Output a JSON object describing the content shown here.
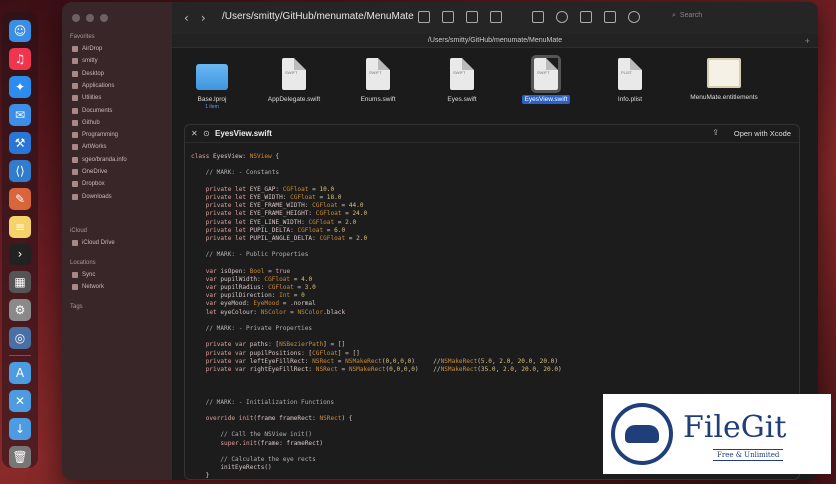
{
  "dock": {
    "apps": [
      {
        "name": "finder-icon",
        "color": "#3a8ee6",
        "glyph": "☺"
      },
      {
        "name": "music-icon",
        "color": "#f0364f",
        "glyph": "♫"
      },
      {
        "name": "safari-icon",
        "color": "#2d8cf0",
        "glyph": "✦"
      },
      {
        "name": "mail-icon",
        "color": "#3b8fe8",
        "glyph": "✉"
      },
      {
        "name": "xcode-icon",
        "color": "#2a76d6",
        "glyph": "⚒"
      },
      {
        "name": "vscode-icon",
        "color": "#2f7dcc",
        "glyph": "⟨⟩"
      },
      {
        "name": "ruler-icon",
        "color": "#d8663a",
        "glyph": "✎"
      },
      {
        "name": "notes-icon",
        "color": "#f5d36a",
        "glyph": "≡"
      },
      {
        "name": "terminal-icon",
        "color": "#222222",
        "glyph": "›"
      },
      {
        "name": "calculator-icon",
        "color": "#555555",
        "glyph": "▦"
      },
      {
        "name": "settings-icon",
        "color": "#8a8a8a",
        "glyph": "⚙"
      },
      {
        "name": "quicklook-icon",
        "color": "#4a6fa5",
        "glyph": "◎"
      },
      {
        "name": "apps-folder-icon",
        "color": "#4d9be0",
        "glyph": "A"
      },
      {
        "name": "tools-folder-icon",
        "color": "#4d9be0",
        "glyph": "✕"
      },
      {
        "name": "downloads-folder-icon",
        "color": "#4d9be0",
        "glyph": "↓"
      },
      {
        "name": "trash-icon",
        "color": "#777777",
        "glyph": "🗑"
      }
    ]
  },
  "sidebar": {
    "favorites_label": "Favorites",
    "favorites": [
      "AirDrop",
      "smitty",
      "Desktop",
      "Applications",
      "Utilities",
      "Documents",
      "Github",
      "Programming",
      "ArtWorks",
      "sgeo/branda.info",
      "OneDrive",
      "Dropbox",
      "Downloads"
    ],
    "icloud_label": "iCloud",
    "icloud": [
      "iCloud Drive"
    ],
    "locations_label": "Locations",
    "locations": [
      "Sync",
      "Network"
    ],
    "tags_label": "Tags"
  },
  "toolbar": {
    "path": "/Users/smitty/GitHub/menumate/MenuMate",
    "search_placeholder": "Search",
    "back_glyph": "‹",
    "forward_glyph": "›"
  },
  "pathbar": {
    "text": "/Users/smitty/GitHub/menumate/MenuMate",
    "plus": "+"
  },
  "files": [
    {
      "name": "Base.lproj",
      "sub": "1 item",
      "kind": "folder",
      "selected": false
    },
    {
      "name": "AppDelegate.swift",
      "kind": "swift",
      "selected": false
    },
    {
      "name": "Enums.swift",
      "kind": "swift",
      "selected": false
    },
    {
      "name": "Eyes.swift",
      "kind": "swift",
      "selected": false
    },
    {
      "name": "EyesView.swift",
      "kind": "swift",
      "selected": true
    },
    {
      "name": "Info.plist",
      "kind": "plist",
      "selected": false
    },
    {
      "name": "MenuMate.entitlements",
      "kind": "cert",
      "selected": false
    }
  ],
  "file_tags": {
    "swift": "SWIFT",
    "plist": "PLIST"
  },
  "quicklook": {
    "close_glyph": "✕",
    "title": "EyesView.swift",
    "share_glyph": "⇪",
    "open_label": "Open with Xcode"
  },
  "code_lines": [
    "class EyesView: NSView {",
    "",
    "    // MARK: - Constants",
    "",
    "    private let EYE_GAP: CGFloat = 10.0",
    "    private let EYE_WIDTH: CGFloat = 18.0",
    "    private let EYE_FRAME_WIDTH: CGFloat = 44.0",
    "    private let EYE_FRAME_HEIGHT: CGFloat = 24.0",
    "    private let EYE_LINE_WIDTH: CGFloat = 2.0",
    "    private let PUPIL_DELTA: CGFloat = 6.0",
    "    private let PUPIL_ANGLE_DELTA: CGFloat = 2.0",
    "",
    "    // MARK: - Public Properties",
    "",
    "    var isOpen: Bool = true",
    "    var pupilWidth: CGFloat = 4.0",
    "    var pupilRadius: CGFloat = 3.0",
    "    var pupilDirection: Int = 0",
    "    var eyeMood: EyeMood = .normal",
    "    let eyeColour: NSColor = NSColor.black",
    "",
    "    // MARK: - Private Properties",
    "",
    "    private var paths: [NSBezierPath] = []",
    "    private var pupilPositions: [CGFloat] = []",
    "    private var leftEyeFillRect: NSRect = NSMakeRect(0,0,0,0)     //NSMakeRect(5.0, 2.0, 20.0, 20.0)",
    "    private var rightEyeFillRect: NSRect = NSMakeRect(0,0,0,0)    //NSMakeRect(35.0, 2.0, 20.0, 20.0)",
    "",
    "",
    "",
    "    // MARK: - Initialization Functions",
    "",
    "    override init(frame frameRect: NSRect) {",
    "",
    "        // Call the NSView init()",
    "        super.init(frame: frameRect)",
    "",
    "        // Calculate the eye rects",
    "        initEyeRects()",
    "    }"
  ],
  "watermark": {
    "name": "FileGit",
    "tagline": "Free & Unlimited"
  }
}
